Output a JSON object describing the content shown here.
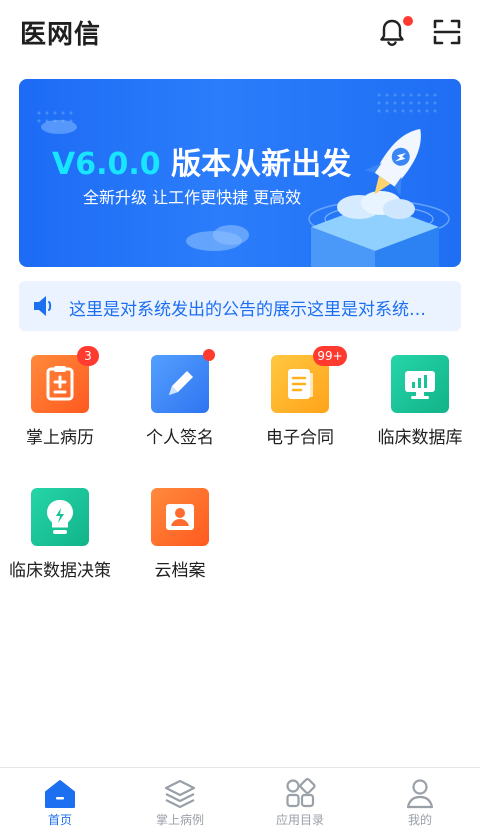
{
  "header": {
    "app_title": "医网信",
    "icons": [
      "bell-icon",
      "scan-icon"
    ],
    "has_notification_dot": true
  },
  "banner": {
    "version": "V6.0.0",
    "title": "版本从新出发",
    "subtitle": "全新升级 让工作更快捷 更高效"
  },
  "notice": {
    "text": "这里是对系统发出的公告的展示这里是对系统…"
  },
  "apps": [
    {
      "label": "掌上病历",
      "badge": "3",
      "icon": "medical-record-icon",
      "color": "#ff6b2e"
    },
    {
      "label": "个人签名",
      "badge_dot": true,
      "icon": "pen-icon",
      "color": "#3a86f7"
    },
    {
      "label": "电子合同",
      "badge": "99+",
      "icon": "document-icon",
      "color": "#ffb21e"
    },
    {
      "label": "临床数据库",
      "icon": "monitor-chart-icon",
      "color": "#18c39a"
    },
    {
      "label": "临床数据决策",
      "icon": "bulb-icon",
      "color": "#18c39a"
    },
    {
      "label": "云档案",
      "icon": "user-archive-icon",
      "color": "#ff6b2e"
    }
  ],
  "tabs": [
    {
      "label": "首页",
      "active": true,
      "icon": "home-icon"
    },
    {
      "label": "掌上病例",
      "icon": "layers-icon"
    },
    {
      "label": "应用目录",
      "icon": "apps-grid-icon"
    },
    {
      "label": "我的",
      "icon": "user-icon"
    }
  ],
  "colors": {
    "primary": "#1d6ff2",
    "badge_red": "#ff3b30",
    "banner_accent": "#18e5ff"
  }
}
